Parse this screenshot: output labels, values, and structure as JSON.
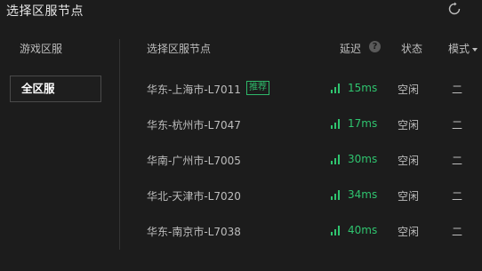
{
  "window": {
    "title": "选择区服节点",
    "refresh_icon": "refresh-icon"
  },
  "sidebar": {
    "header": "游戏区服",
    "items": [
      {
        "label": "全区服",
        "selected": true
      }
    ]
  },
  "table": {
    "headers": {
      "node": "选择区服节点",
      "latency": "延迟",
      "status": "状态",
      "mode": "模式"
    },
    "rows": [
      {
        "name": "华东-上海市-L7011",
        "tag": "推荐",
        "latency": "15ms",
        "status": "空闲",
        "mode": "二"
      },
      {
        "name": "华东-杭州市-L7047",
        "tag": "",
        "latency": "17ms",
        "status": "空闲",
        "mode": "二"
      },
      {
        "name": "华南-广州市-L7005",
        "tag": "",
        "latency": "30ms",
        "status": "空闲",
        "mode": "二"
      },
      {
        "name": "华北-天津市-L7020",
        "tag": "",
        "latency": "34ms",
        "status": "空闲",
        "mode": "二"
      },
      {
        "name": "华东-南京市-L7038",
        "tag": "",
        "latency": "40ms",
        "status": "空闲",
        "mode": "二"
      }
    ]
  },
  "colors": {
    "accent_green": "#2fc46f",
    "tag_green": "#2fb96a",
    "background": "#1c1c1c"
  }
}
